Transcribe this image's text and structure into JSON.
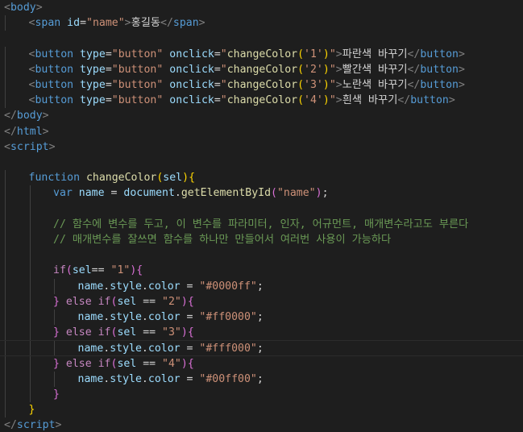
{
  "editor": {
    "language": "html",
    "lines": [
      {
        "indent": 0,
        "tokens": [
          [
            "tag",
            "<"
          ],
          [
            "tn",
            "body"
          ],
          [
            "tag",
            ">"
          ]
        ]
      },
      {
        "indent": 1,
        "tokens": [
          [
            "tag",
            "<"
          ],
          [
            "tn",
            "span"
          ],
          [
            "tx",
            " "
          ],
          [
            "at",
            "id"
          ],
          [
            "tx",
            "="
          ],
          [
            "st",
            "\"name\""
          ],
          [
            "tag",
            ">"
          ],
          [
            "tx",
            "홍길동"
          ],
          [
            "tag",
            "</"
          ],
          [
            "tn",
            "span"
          ],
          [
            "tag",
            ">"
          ]
        ]
      },
      {
        "indent": 0,
        "tokens": []
      },
      {
        "indent": 1,
        "tokens": [
          [
            "tag",
            "<"
          ],
          [
            "tn",
            "button"
          ],
          [
            "tx",
            " "
          ],
          [
            "at",
            "type"
          ],
          [
            "tx",
            "="
          ],
          [
            "st",
            "\"button\""
          ],
          [
            "tx",
            " "
          ],
          [
            "at",
            "onclick"
          ],
          [
            "tx",
            "="
          ],
          [
            "st",
            "\""
          ],
          [
            "fn",
            "changeColor"
          ],
          [
            "b1",
            "("
          ],
          [
            "st",
            "'1'"
          ],
          [
            "b1",
            ")"
          ],
          [
            "st",
            "\""
          ],
          [
            "tag",
            ">"
          ],
          [
            "tx",
            "파란색 바꾸기"
          ],
          [
            "tag",
            "</"
          ],
          [
            "tn",
            "button"
          ],
          [
            "tag",
            ">"
          ]
        ]
      },
      {
        "indent": 1,
        "tokens": [
          [
            "tag",
            "<"
          ],
          [
            "tn",
            "button"
          ],
          [
            "tx",
            " "
          ],
          [
            "at",
            "type"
          ],
          [
            "tx",
            "="
          ],
          [
            "st",
            "\"button\""
          ],
          [
            "tx",
            " "
          ],
          [
            "at",
            "onclick"
          ],
          [
            "tx",
            "="
          ],
          [
            "st",
            "\""
          ],
          [
            "fn",
            "changeColor"
          ],
          [
            "b1",
            "("
          ],
          [
            "st",
            "'2'"
          ],
          [
            "b1",
            ")"
          ],
          [
            "st",
            "\""
          ],
          [
            "tag",
            ">"
          ],
          [
            "tx",
            "빨간색 바꾸기"
          ],
          [
            "tag",
            "</"
          ],
          [
            "tn",
            "button"
          ],
          [
            "tag",
            ">"
          ]
        ]
      },
      {
        "indent": 1,
        "tokens": [
          [
            "tag",
            "<"
          ],
          [
            "tn",
            "button"
          ],
          [
            "tx",
            " "
          ],
          [
            "at",
            "type"
          ],
          [
            "tx",
            "="
          ],
          [
            "st",
            "\"button\""
          ],
          [
            "tx",
            " "
          ],
          [
            "at",
            "onclick"
          ],
          [
            "tx",
            "="
          ],
          [
            "st",
            "\""
          ],
          [
            "fn",
            "changeColor"
          ],
          [
            "b1",
            "("
          ],
          [
            "st",
            "'3'"
          ],
          [
            "b1",
            ")"
          ],
          [
            "st",
            "\""
          ],
          [
            "tag",
            ">"
          ],
          [
            "tx",
            "노란색 바꾸기"
          ],
          [
            "tag",
            "</"
          ],
          [
            "tn",
            "button"
          ],
          [
            "tag",
            ">"
          ]
        ]
      },
      {
        "indent": 1,
        "tokens": [
          [
            "tag",
            "<"
          ],
          [
            "tn",
            "button"
          ],
          [
            "tx",
            " "
          ],
          [
            "at",
            "type"
          ],
          [
            "tx",
            "="
          ],
          [
            "st",
            "\"button\""
          ],
          [
            "tx",
            " "
          ],
          [
            "at",
            "onclick"
          ],
          [
            "tx",
            "="
          ],
          [
            "st",
            "\""
          ],
          [
            "fn",
            "changeColor"
          ],
          [
            "b1",
            "("
          ],
          [
            "st",
            "'4'"
          ],
          [
            "b1",
            ")"
          ],
          [
            "st",
            "\""
          ],
          [
            "tag",
            ">"
          ],
          [
            "tx",
            "흰색 바꾸기"
          ],
          [
            "tag",
            "</"
          ],
          [
            "tn",
            "button"
          ],
          [
            "tag",
            ">"
          ]
        ]
      },
      {
        "indent": 0,
        "tokens": [
          [
            "tag",
            "</"
          ],
          [
            "tn",
            "body"
          ],
          [
            "tag",
            ">"
          ]
        ]
      },
      {
        "indent": 0,
        "tokens": [
          [
            "tag",
            "</"
          ],
          [
            "tn",
            "html"
          ],
          [
            "tag",
            ">"
          ]
        ]
      },
      {
        "indent": 0,
        "tokens": [
          [
            "tag",
            "<"
          ],
          [
            "tn",
            "script"
          ],
          [
            "tag",
            ">"
          ]
        ]
      },
      {
        "indent": 0,
        "tokens": []
      },
      {
        "indent": 1,
        "tokens": [
          [
            "kw",
            "function"
          ],
          [
            "tx",
            " "
          ],
          [
            "fn",
            "changeColor"
          ],
          [
            "b1",
            "("
          ],
          [
            "vr",
            "sel"
          ],
          [
            "b1",
            ")"
          ],
          [
            "b1",
            "{"
          ]
        ]
      },
      {
        "indent": 2,
        "tokens": [
          [
            "kw",
            "var"
          ],
          [
            "tx",
            " "
          ],
          [
            "vr",
            "name"
          ],
          [
            "op",
            " = "
          ],
          [
            "vr",
            "document"
          ],
          [
            "op",
            "."
          ],
          [
            "fn",
            "getElementById"
          ],
          [
            "b2",
            "("
          ],
          [
            "st",
            "\"name\""
          ],
          [
            "b2",
            ")"
          ],
          [
            "op",
            ";"
          ]
        ]
      },
      {
        "indent": 2,
        "tokens": []
      },
      {
        "indent": 2,
        "tokens": [
          [
            "cm",
            "// 함수에 변수를 두고, 이 변수를 파라미터, 인자, 어규먼트, 매개변수라고도 부른다"
          ]
        ]
      },
      {
        "indent": 2,
        "tokens": [
          [
            "cm",
            "// 매개변수를 잘쓰면 함수를 하나만 만들어서 여러번 사용이 가능하다"
          ]
        ]
      },
      {
        "indent": 2,
        "tokens": []
      },
      {
        "indent": 2,
        "tokens": [
          [
            "cf",
            "if"
          ],
          [
            "b2",
            "("
          ],
          [
            "vr",
            "sel"
          ],
          [
            "op",
            "=="
          ],
          [
            "tx",
            " "
          ],
          [
            "st",
            "\"1\""
          ],
          [
            "b2",
            ")"
          ],
          [
            "b2",
            "{"
          ]
        ]
      },
      {
        "indent": 3,
        "tokens": [
          [
            "vr",
            "name"
          ],
          [
            "op",
            "."
          ],
          [
            "vr",
            "style"
          ],
          [
            "op",
            "."
          ],
          [
            "vr",
            "color"
          ],
          [
            "op",
            " = "
          ],
          [
            "st",
            "\"#0000ff\""
          ],
          [
            "op",
            ";"
          ]
        ]
      },
      {
        "indent": 2,
        "tokens": [
          [
            "b2",
            "}"
          ],
          [
            "tx",
            " "
          ],
          [
            "cf",
            "else if"
          ],
          [
            "b2",
            "("
          ],
          [
            "vr",
            "sel"
          ],
          [
            "op",
            " == "
          ],
          [
            "st",
            "\"2\""
          ],
          [
            "b2",
            ")"
          ],
          [
            "b2",
            "{"
          ]
        ]
      },
      {
        "indent": 3,
        "tokens": [
          [
            "vr",
            "name"
          ],
          [
            "op",
            "."
          ],
          [
            "vr",
            "style"
          ],
          [
            "op",
            "."
          ],
          [
            "vr",
            "color"
          ],
          [
            "op",
            " = "
          ],
          [
            "st",
            "\"#ff0000\""
          ],
          [
            "op",
            ";"
          ]
        ]
      },
      {
        "indent": 2,
        "tokens": [
          [
            "b2",
            "}"
          ],
          [
            "tx",
            " "
          ],
          [
            "cf",
            "else if"
          ],
          [
            "b2",
            "("
          ],
          [
            "vr",
            "sel"
          ],
          [
            "op",
            " == "
          ],
          [
            "st",
            "\"3\""
          ],
          [
            "b2",
            ")"
          ],
          [
            "b2",
            "{"
          ]
        ]
      },
      {
        "indent": 3,
        "current": true,
        "tokens": [
          [
            "vr",
            "name"
          ],
          [
            "op",
            "."
          ],
          [
            "vr",
            "style"
          ],
          [
            "op",
            "."
          ],
          [
            "vr",
            "color"
          ],
          [
            "op",
            " = "
          ],
          [
            "st",
            "\"#fff000\""
          ],
          [
            "op",
            ";"
          ]
        ]
      },
      {
        "indent": 2,
        "tokens": [
          [
            "b2",
            "}"
          ],
          [
            "tx",
            " "
          ],
          [
            "cf",
            "else if"
          ],
          [
            "b2",
            "("
          ],
          [
            "vr",
            "sel"
          ],
          [
            "op",
            " == "
          ],
          [
            "st",
            "\"4\""
          ],
          [
            "b2",
            ")"
          ],
          [
            "b2",
            "{"
          ]
        ]
      },
      {
        "indent": 3,
        "tokens": [
          [
            "vr",
            "name"
          ],
          [
            "op",
            "."
          ],
          [
            "vr",
            "style"
          ],
          [
            "op",
            "."
          ],
          [
            "vr",
            "color"
          ],
          [
            "op",
            " = "
          ],
          [
            "st",
            "\"#00ff00\""
          ],
          [
            "op",
            ";"
          ]
        ]
      },
      {
        "indent": 2,
        "tokens": [
          [
            "b2",
            "}"
          ]
        ]
      },
      {
        "indent": 1,
        "tokens": [
          [
            "b1",
            "}"
          ]
        ]
      },
      {
        "indent": 0,
        "tokens": [
          [
            "tag",
            "</"
          ],
          [
            "tn",
            "script"
          ],
          [
            "tag",
            ">"
          ]
        ]
      }
    ]
  }
}
